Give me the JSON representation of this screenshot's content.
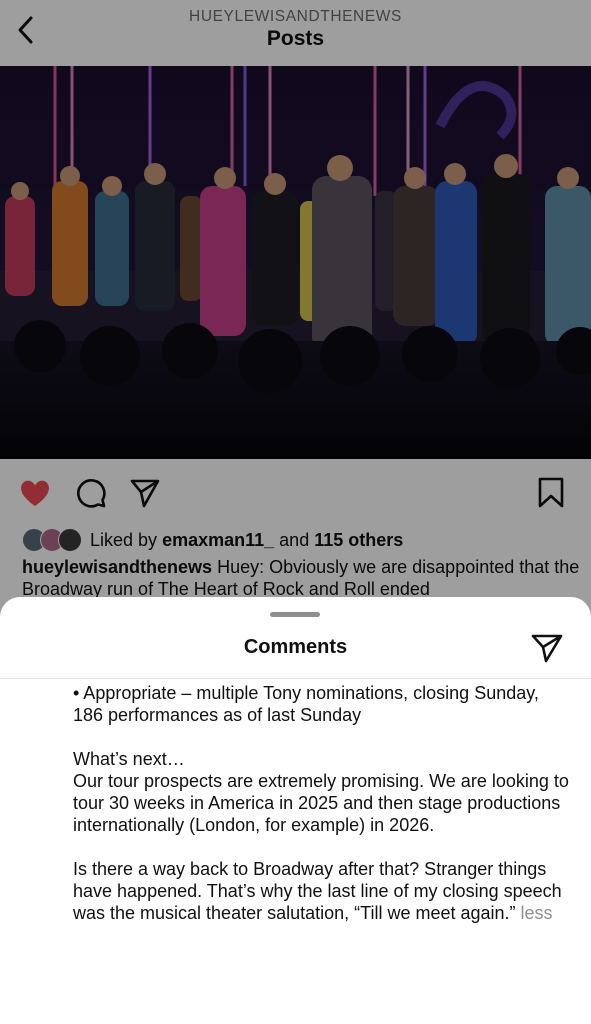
{
  "header": {
    "account_name": "HUEYLEWISANDTHENEWS",
    "title": "Posts"
  },
  "post": {
    "liked_by_prefix": "Liked by",
    "liked_by_user": "emaxman11_",
    "liked_by_and": "and",
    "liked_by_others": "115 others",
    "caption_user": "hueylewisandthenews",
    "caption_text": "Huey: Obviously we are disappointed that the Broadway run of The Heart of Rock and Roll ended"
  },
  "icons": {
    "back": "chevron-left-icon",
    "like": "heart-icon",
    "comment": "comment-icon",
    "share": "paper-plane-icon",
    "save": "bookmark-icon",
    "like_color": "#ed4956"
  },
  "comments_sheet": {
    "title": "Comments",
    "paragraphs": [
      "• Appropriate – multiple Tony nominations, closing Sunday, 186 performances as of last Sunday",
      "What’s next…",
      "Our tour prospects are extremely promising. We are looking to tour 30 weeks in America in 2025 and then stage productions internationally (London, for example) in 2026.",
      "Is there a way back to Broadway after that? Stranger things have happened. That’s why the last line of my closing speech was the musical theater salutation, “Till we meet again.”"
    ],
    "less_label": "less"
  }
}
